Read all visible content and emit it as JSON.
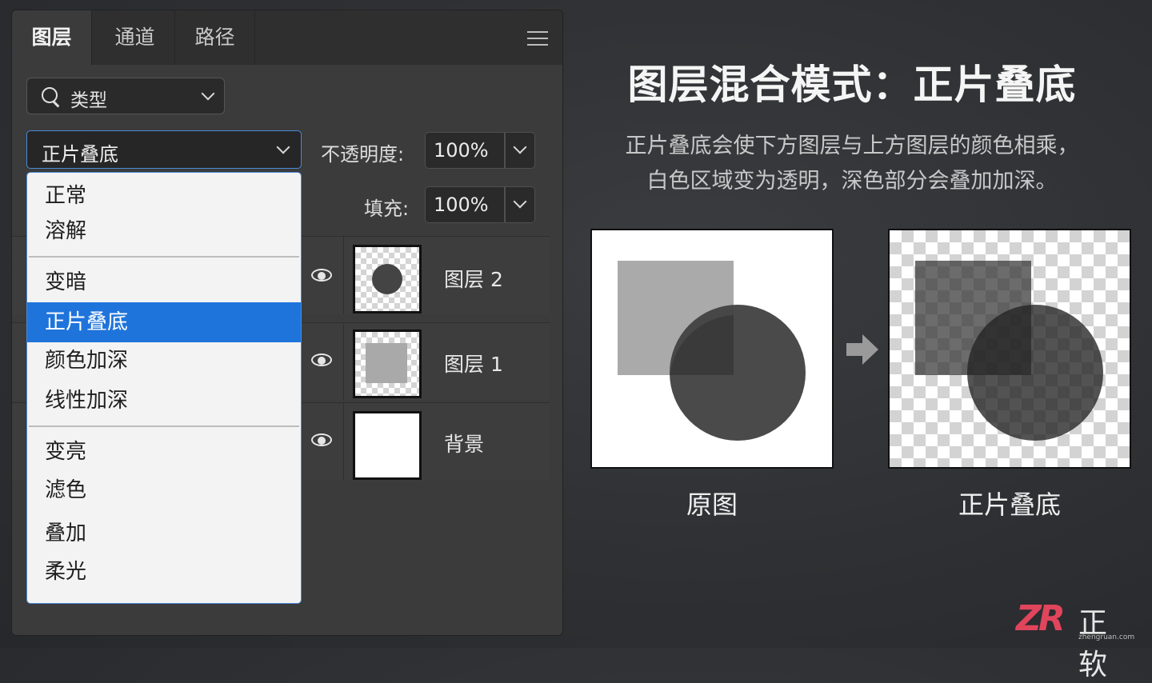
{
  "tabs": [
    {
      "label": "图层",
      "active": true
    },
    {
      "label": "通道",
      "active": false
    },
    {
      "label": "路径",
      "active": false
    }
  ],
  "filter": {
    "label": "类型"
  },
  "blend_mode": {
    "selected": "正片叠底"
  },
  "opacity": {
    "label": "不透明度:",
    "value": "100%"
  },
  "fill": {
    "label": "填充:",
    "value": "100%"
  },
  "dropdown": {
    "options": [
      "正常",
      "溶解",
      "变暗",
      "正片叠底",
      "颜色加深",
      "线性加深",
      "变亮",
      "滤色",
      "叠加",
      "柔光"
    ],
    "selected": "正片叠底"
  },
  "layers": [
    {
      "name": "图层 2",
      "thumbnail": "circle"
    },
    {
      "name": "图层 1",
      "thumbnail": "square"
    },
    {
      "name": "背景",
      "thumbnail": "white"
    }
  ],
  "title": "图层混合模式：正片叠底",
  "description": [
    "正片叠底会使下方图层与上方图层的颜色相乘，",
    "白色区域变为透明，深色部分会叠加加深。"
  ],
  "captions": {
    "original": "原图",
    "multiply": "正片叠底"
  },
  "logo": {
    "mark": "ZR",
    "name": "正软",
    "url": "zhengruan.com"
  },
  "colors": {
    "accent": "#1f74db",
    "logo": "#e0455c",
    "shape_light": "#aaaaaa",
    "shape_dark": "#444444"
  }
}
